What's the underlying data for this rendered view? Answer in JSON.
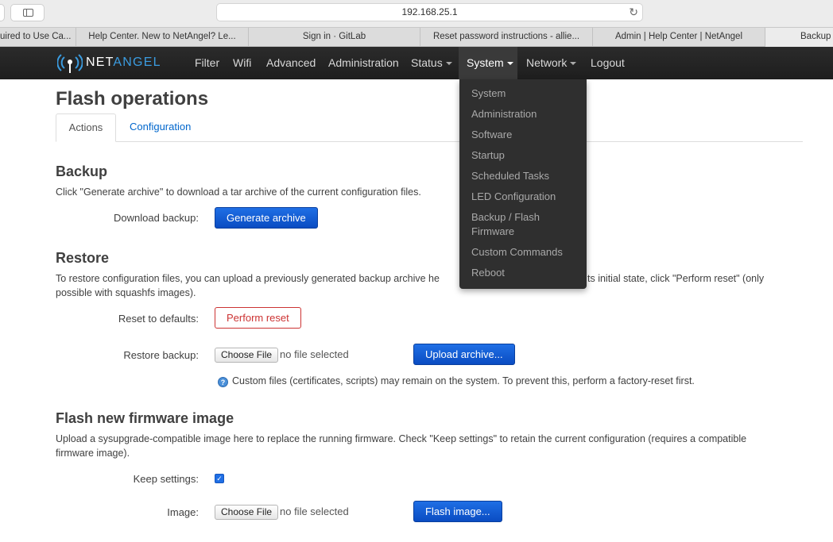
{
  "browser": {
    "url": "192.168.25.1",
    "tabs": [
      {
        "label": "uired to Use Ca..."
      },
      {
        "label": "Help Center. New to NetAngel? Le..."
      },
      {
        "label": "Sign in · GitLab"
      },
      {
        "label": "Reset password instructions - allie..."
      },
      {
        "label": "Admin | Help Center | NetAngel"
      },
      {
        "label": "Backup"
      }
    ]
  },
  "logo": {
    "net": "NET",
    "angel": "ANGEL"
  },
  "nav": {
    "filter": "Filter",
    "wifi": "Wifi",
    "advanced": "Advanced",
    "administration": "Administration",
    "status": "Status",
    "system": "System",
    "network": "Network",
    "logout": "Logout"
  },
  "system_menu": [
    {
      "label": "System"
    },
    {
      "label": "Administration"
    },
    {
      "label": "Software"
    },
    {
      "label": "Startup"
    },
    {
      "label": "Scheduled Tasks"
    },
    {
      "label": "LED Configuration"
    },
    {
      "label": "Backup / Flash Firmware"
    },
    {
      "label": "Custom Commands"
    },
    {
      "label": "Reboot"
    }
  ],
  "page": {
    "title": "Flash operations",
    "tabs": {
      "actions": "Actions",
      "configuration": "Configuration"
    }
  },
  "backup": {
    "heading": "Backup",
    "description": "Click \"Generate archive\" to download a tar archive of the current configuration files.",
    "download_label": "Download backup:",
    "generate_button": "Generate archive"
  },
  "restore": {
    "heading": "Restore",
    "description_1": "To restore configuration files, you can upload a previously generated backup archive he",
    "description_2": "ts initial state, click \"Perform reset\" (only",
    "description_3": "possible with squashfs images).",
    "reset_label": "Reset to defaults:",
    "reset_button": "Perform reset",
    "restore_label": "Restore backup:",
    "choose_file": "Choose File",
    "no_file": "no file selected",
    "upload_button": "Upload archive...",
    "help_note": "Custom files (certificates, scripts) may remain on the system. To prevent this, perform a factory-reset first."
  },
  "flash": {
    "heading": "Flash new firmware image",
    "description_1": "Upload a sysupgrade-compatible image here to replace the running firmware. Check \"Keep settings\" to retain the current configuration (requires a compatible",
    "description_2": "firmware image).",
    "keep_label": "Keep settings:",
    "keep_checked": true,
    "image_label": "Image:",
    "choose_file": "Choose File",
    "no_file": "no file selected",
    "flash_button": "Flash image..."
  },
  "colors": {
    "primary_button": "#0a4cc2",
    "danger": "#cc3333",
    "link": "#0066cc",
    "navbar": "#222222",
    "logo_accent": "#3b9ce0"
  }
}
